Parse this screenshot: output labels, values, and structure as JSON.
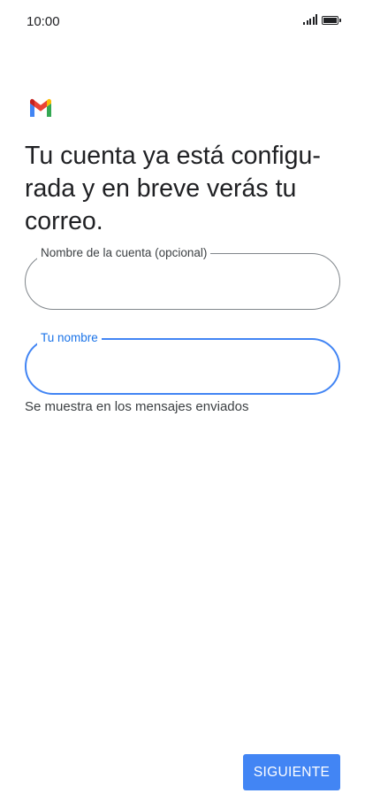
{
  "status_bar": {
    "time": "10:00",
    "icons": [
      "signal-icon",
      "battery-icon"
    ]
  },
  "logo": {
    "icon": "gmail-logo-icon",
    "colors": [
      "#4285f4",
      "#ea4335",
      "#fbbc04",
      "#34a853",
      "#c5221f"
    ]
  },
  "headline": "Tu cuenta ya está configu-rada y en breve verás tu correo.",
  "headline_lines": [
    "Tu cuenta ya está configu-",
    "rada y en breve verás tu",
    "correo."
  ],
  "fields": {
    "account_name": {
      "label": "Nombre de la cuenta (opcional)",
      "value": ""
    },
    "your_name": {
      "label": "Tu nombre",
      "value": "",
      "focused": true
    }
  },
  "helper_text": "Se muestra en los mensajes enviados",
  "actions": {
    "next_label": "SIGUIENTE"
  },
  "colors": {
    "accent": "#4285f4",
    "text": "#202124",
    "outline": "#80868b"
  }
}
